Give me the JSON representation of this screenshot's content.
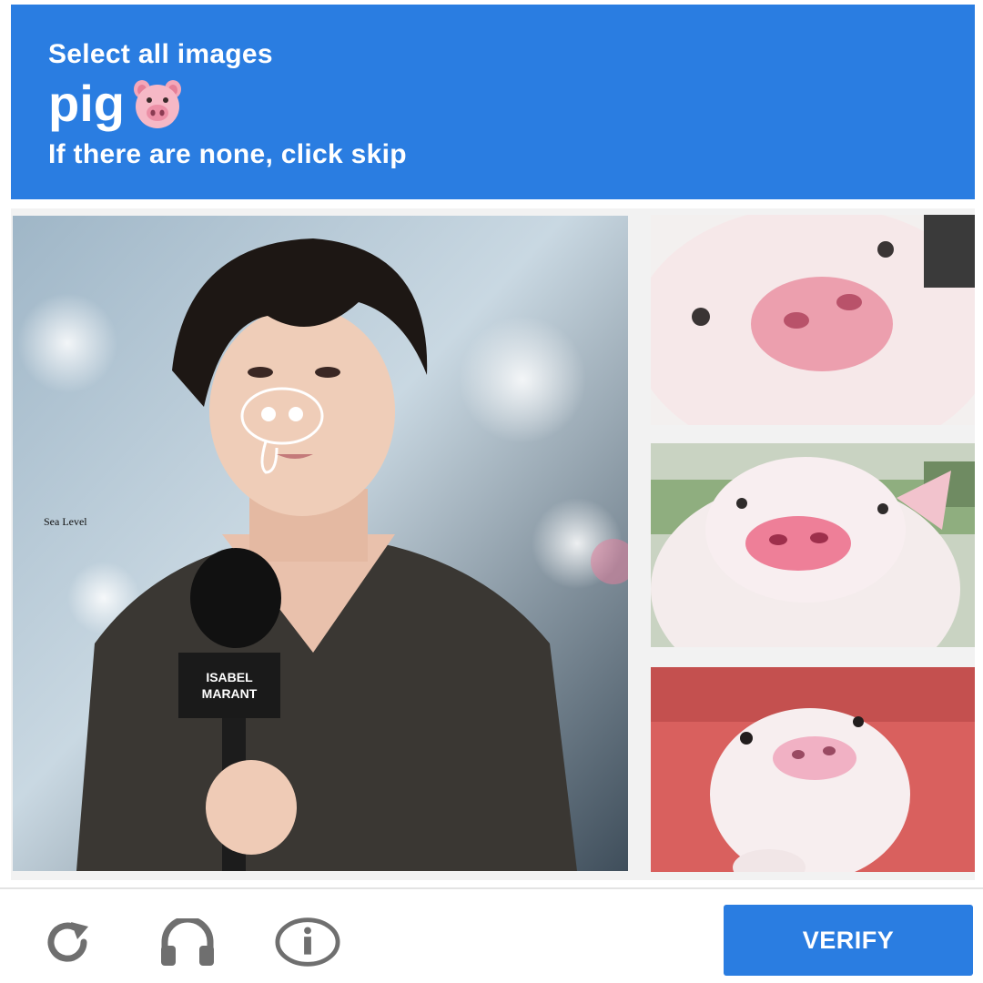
{
  "header": {
    "line1": "Select all images",
    "line2": "pig",
    "line2_emoji_icon": "pig-face-icon",
    "line3": "If there are none, click skip"
  },
  "tiles": [
    {
      "name": "man-with-microphone",
      "caption": "Sea Level",
      "mic_flag": "ISABEL MARANT"
    },
    {
      "name": "pig-closeup-snout"
    },
    {
      "name": "pig-sitting-on-grass"
    },
    {
      "name": "pig-on-red-background"
    }
  ],
  "footer": {
    "reload_icon": "reload-icon",
    "audio_icon": "headphones-icon",
    "info_icon": "info-icon",
    "verify_label": "VERIFY"
  },
  "colors": {
    "accent": "#2a7de1",
    "icon_gray": "#6f6f6f"
  }
}
